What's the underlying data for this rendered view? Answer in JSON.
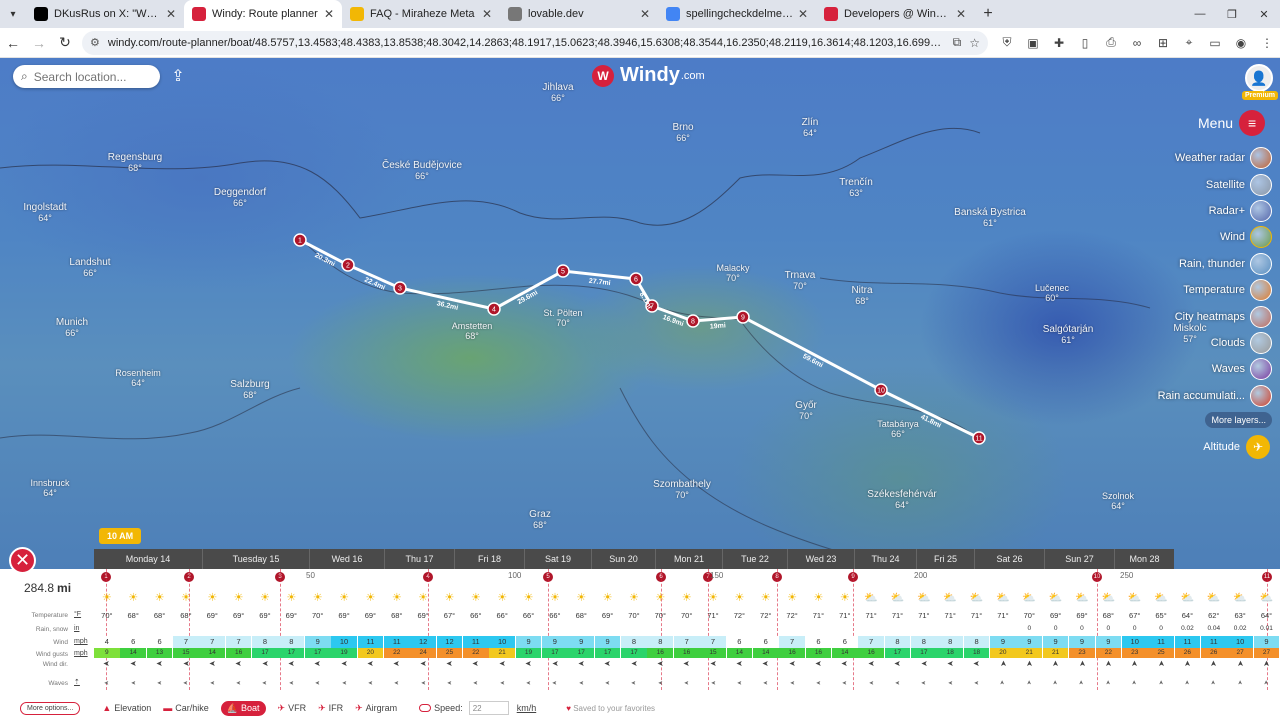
{
  "browser": {
    "tabs": [
      {
        "title": "DKusRus on X: \"What never re",
        "icon": "x-logo-icon",
        "color": "#000000"
      },
      {
        "title": "Windy: Route planner",
        "icon": "windy-logo-icon",
        "color": "#d6213c",
        "active": true
      },
      {
        "title": "FAQ - Miraheze Meta",
        "icon": "miraheze-icon",
        "color": "#f2b705"
      },
      {
        "title": "lovable.dev",
        "icon": "globe-icon",
        "color": "#777777"
      },
      {
        "title": "spellingcheckdelme - Google D",
        "icon": "google-docs-icon",
        "color": "#4285f4"
      },
      {
        "title": "Developers @ Windy Commun",
        "icon": "windy-logo-icon",
        "color": "#d6213c"
      }
    ],
    "url": "windy.com/route-planner/boat/48.5757,13.4583;48.4383,13.8538;48.3042,14.2863;48.1917,15.0623;48.3946,15.6308;48.3544,16.2350;48.2119,16.3614;48.1203,16.6992;48.1441,17.1085;47.7430,18.2510;47.48..."
  },
  "map": {
    "search_placeholder": "Search location...",
    "logo": "Windy",
    "logo_suffix": ".com",
    "premium_label": "Premium",
    "menu_label": "Menu",
    "time_label": "10 AM",
    "layers": [
      {
        "label": "Weather radar",
        "color": "#c06030"
      },
      {
        "label": "Satellite",
        "color": "#8a96a6"
      },
      {
        "label": "Radar+",
        "color": "#5566aa"
      },
      {
        "label": "Wind",
        "color": "#6a9a4a",
        "selected": true
      },
      {
        "label": "Rain, thunder",
        "color": "#5a8fc0"
      },
      {
        "label": "Temperature",
        "color": "#e07a2a"
      },
      {
        "label": "City heatmaps",
        "color": "#c06a5a"
      },
      {
        "label": "Clouds",
        "color": "#999999"
      },
      {
        "label": "Waves",
        "color": "#7a3aa0"
      },
      {
        "label": "Rain accumulati...",
        "color": "#d0402a"
      }
    ],
    "more_layers": "More layers...",
    "altitude_label": "Altitude",
    "cities": [
      {
        "name": "Regensburg",
        "temp": "68°"
      },
      {
        "name": "Ingolstadt",
        "temp": "64°"
      },
      {
        "name": "Landshut",
        "temp": "66°"
      },
      {
        "name": "Munich",
        "temp": "66°"
      },
      {
        "name": "Salzburg",
        "temp": "68°"
      },
      {
        "name": "Deggendorf",
        "temp": "66°"
      },
      {
        "name": "České Budějovice",
        "temp": "66°"
      },
      {
        "name": "Jihlava",
        "temp": "66°"
      },
      {
        "name": "Brno",
        "temp": "66°"
      },
      {
        "name": "Zlín",
        "temp": "64°"
      },
      {
        "name": "Trenčín",
        "temp": "63°"
      },
      {
        "name": "Banská Bystrica",
        "temp": "61°"
      },
      {
        "name": "Trnava",
        "temp": "70°"
      },
      {
        "name": "Nitra",
        "temp": "68°"
      },
      {
        "name": "Győr",
        "temp": "70°"
      },
      {
        "name": "Salgótarján",
        "temp": "61°"
      },
      {
        "name": "Miskolc",
        "temp": "57°"
      },
      {
        "name": "Szombathely",
        "temp": "70°"
      },
      {
        "name": "Graz",
        "temp": "68°"
      },
      {
        "name": "Székesfehérvár",
        "temp": "64°"
      },
      {
        "name": "Szolnok",
        "temp": "64°"
      },
      {
        "name": "Amstetten",
        "temp": "68°"
      },
      {
        "name": "St. Pölten",
        "temp": "70°"
      },
      {
        "name": "Tatabánya",
        "temp": "66°"
      },
      {
        "name": "Innsbruck",
        "temp": "64°"
      },
      {
        "name": "Rosenheim",
        "temp": "64°"
      },
      {
        "name": "Lučenec",
        "temp": "60°"
      },
      {
        "name": "Malacky",
        "temp": "70°"
      }
    ],
    "waypoints": [
      "1",
      "2",
      "3",
      "4",
      "5",
      "6",
      "7",
      "8",
      "9",
      "10",
      "11"
    ],
    "segments": [
      "20.3mi",
      "22.4mi",
      "36.2mi",
      "29.6mi",
      "27.7mi",
      "8.1mi",
      "16.9mi",
      "19mi",
      "59.6mi",
      "41.8mi"
    ]
  },
  "route": {
    "distance_value": "284.8",
    "distance_unit": "mi",
    "days": [
      "Monday 14",
      "Tuesday 15",
      "Wed 16",
      "Thu 17",
      "Fri 18",
      "Sat 19",
      "Sun 20",
      "Mon 21",
      "Tue 22",
      "Wed 23",
      "Thu 24",
      "Fri 25",
      "Sat 26",
      "Sun 27",
      "Mon 28"
    ],
    "dist_ticks": [
      "50",
      "100",
      "150",
      "200",
      "250"
    ],
    "row_labels": {
      "temperature": "Temperature",
      "rain": "Rain, snow",
      "wind": "Wind",
      "gusts": "Wind gusts",
      "wind_dir": "Wind dir.",
      "waves": "Waves"
    },
    "row_units": {
      "temperature": "°F",
      "rain": "in",
      "wind": "mph",
      "gusts": "mph"
    },
    "temps": [
      "70°",
      "68°",
      "68°",
      "68°",
      "69°",
      "69°",
      "69°",
      "69°",
      "70°",
      "69°",
      "69°",
      "68°",
      "69°",
      "67°",
      "66°",
      "66°",
      "66°",
      "66°",
      "68°",
      "69°",
      "70°",
      "70°",
      "70°",
      "71°",
      "72°",
      "72°",
      "72°",
      "71°",
      "71°",
      "71°",
      "71°",
      "71°",
      "71°",
      "71°",
      "71°",
      "70°",
      "69°",
      "69°",
      "68°",
      "67°",
      "65°",
      "64°",
      "62°",
      "63°",
      "64°"
    ],
    "rain": [
      "",
      "",
      "",
      "",
      "",
      "",
      "",
      "",
      "",
      "",
      "",
      "",
      "",
      "",
      "",
      "",
      "",
      "",
      "",
      "",
      "",
      "",
      "",
      "",
      "",
      "",
      "",
      "",
      "",
      "",
      "",
      "",
      "",
      "",
      "",
      "0",
      "0",
      "0",
      "0",
      "0",
      "0",
      "0.02",
      "0.04",
      "0.02",
      "0.01"
    ],
    "wind": [
      "4",
      "6",
      "6",
      "7",
      "7",
      "7",
      "8",
      "8",
      "9",
      "10",
      "11",
      "11",
      "12",
      "12",
      "11",
      "10",
      "9",
      "9",
      "9",
      "9",
      "8",
      "8",
      "7",
      "7",
      "6",
      "6",
      "7",
      "6",
      "6",
      "7",
      "8",
      "8",
      "8",
      "8",
      "9",
      "9",
      "9",
      "9",
      "9",
      "10",
      "11",
      "11",
      "11",
      "10",
      "9"
    ],
    "gusts": [
      "9",
      "14",
      "13",
      "15",
      "14",
      "16",
      "17",
      "17",
      "17",
      "19",
      "20",
      "22",
      "24",
      "25",
      "22",
      "21",
      "19",
      "17",
      "17",
      "17",
      "17",
      "16",
      "16",
      "15",
      "14",
      "14",
      "16",
      "16",
      "14",
      "16",
      "17",
      "17",
      "18",
      "18",
      "20",
      "21",
      "21",
      "23",
      "22",
      "23",
      "25",
      "26",
      "26",
      "27",
      "27"
    ],
    "weather_icons": [
      "sun",
      "sun",
      "sun",
      "sun",
      "sun",
      "sun",
      "sun",
      "sun",
      "sun",
      "sun",
      "sun",
      "sun",
      "sun",
      "sun",
      "sun",
      "sun",
      "sun",
      "sun",
      "sun",
      "sun",
      "sun",
      "sun",
      "sun",
      "sun",
      "sun",
      "sun",
      "sun",
      "sun",
      "sun",
      "cloud",
      "cloud",
      "cloud",
      "cloud",
      "cloud",
      "cloud",
      "cloud",
      "cloud",
      "cloud",
      "cloud",
      "cloud",
      "cloud",
      "cloud",
      "cloud",
      "cloud",
      "cloud"
    ],
    "more_options": "More options...",
    "modes": [
      {
        "label": "Elevation",
        "icon": "mountain-icon"
      },
      {
        "label": "Car/hike",
        "icon": "car-icon"
      },
      {
        "label": "Boat",
        "icon": "boat-icon",
        "active": true
      },
      {
        "label": "VFR",
        "icon": "plane-icon"
      },
      {
        "label": "IFR",
        "icon": "plane-icon"
      },
      {
        "label": "Airgram",
        "icon": "plane-icon"
      }
    ],
    "speed_label": "Speed:",
    "speed_value": "22",
    "speed_unit": "km/h",
    "saved_text": "Saved to your favorites"
  }
}
